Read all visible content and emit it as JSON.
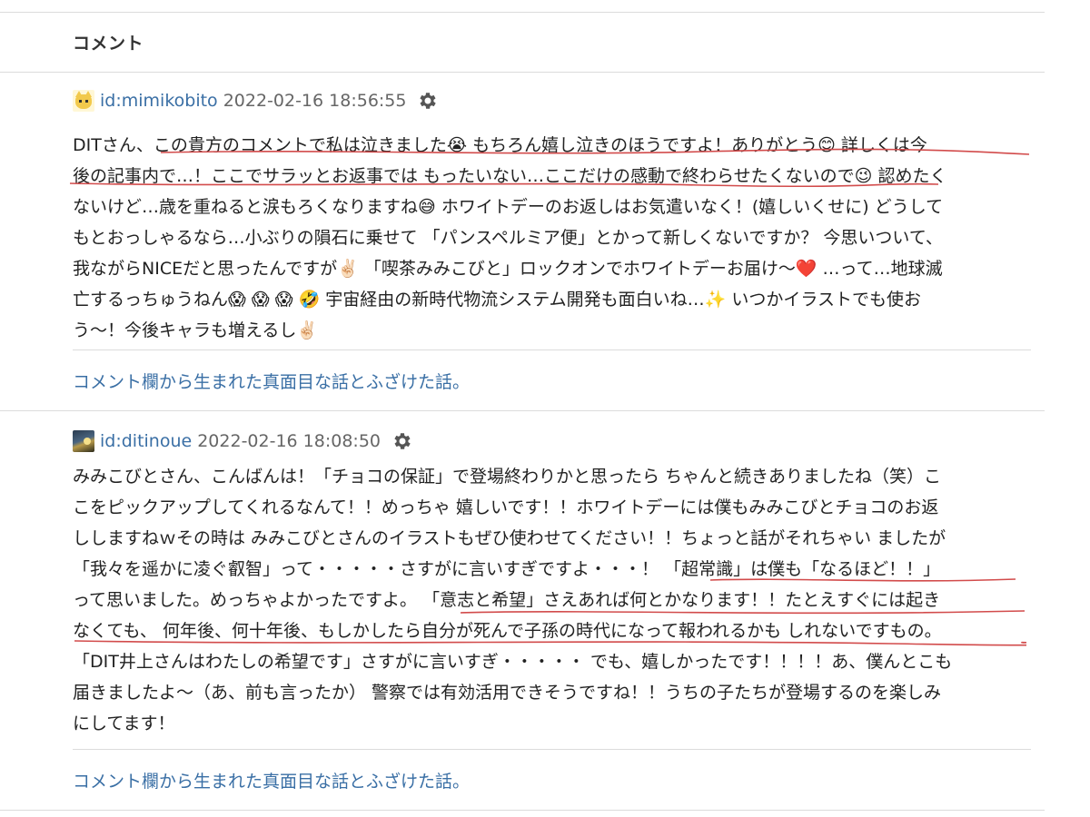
{
  "section": {
    "title": "コメント"
  },
  "comments": [
    {
      "user_id": "id:mimikobito",
      "timestamp": "2022-02-16 18:56:55",
      "avatar_icon": "cat-avatar-icon",
      "lines": [
        "DITさん、この貴方のコメントで私は泣きました😭 もちろん嬉し泣きのほうですよ！ありがとう😊 詳しくは今",
        "後の記事内で…！ここでサラッとお返事では もったいない…ここだけの感動で終わらせたくないので😉 認めたく",
        "ないけど…歳を重ねると涙もろくなりますね😅 ホワイトデーのお返しはお気遣いなく！(嬉しいくせに) どうして",
        "もとおっしゃるなら…小ぶりの隕石に乗せて 「パンスペルミア便」とかって新しくないですか？ 今思いついて、",
        "我ながらNICEだと思ったんですが✌🏻 「喫茶みみこびと」ロックオンでホワイトデーお届け〜❤️ …って…地球滅",
        "亡するっちゅうねん😱 😱 😱 🤣 宇宙経由の新時代物流システム開発も面白いね…✨ いつかイラストでも使お",
        "う〜！今後キャラも増えるし✌🏻"
      ],
      "entry_link": "コメント欄から生まれた真面目な話とふざけた話。"
    },
    {
      "user_id": "id:ditinoue",
      "timestamp": "2022-02-16 18:08:50",
      "avatar_icon": "photo-avatar-icon",
      "lines": [
        "みみこびとさん、こんばんは！「チョコの保証」で登場終わりかと思ったら ちゃんと続きありましたね（笑）こ",
        "こをピックアップしてくれるなんて！！めっちゃ 嬉しいです！！ホワイトデーには僕もみみこびとチョコのお返",
        "ししますねｗその時は みみこびとさんのイラストもぜひ使わせてください！！ちょっと話がそれちゃい ましたが",
        "「我々を遥かに凌ぐ叡智」って・・・・・さすがに言いすぎですよ・・・！ 「超常識」は僕も「なるほど！！」",
        "って思いました。めっちゃよかったですよ。 「意志と希望」さえあれば何とかなります！！たとえすぐには起き",
        "なくても、 何年後、何十年後、もしかしたら自分が死んで子孫の時代になって報われるかも しれないですもの。",
        "「DIT井上さんはわたしの希望です」さすがに言いすぎ・・・・・ でも、嬉しかったです！！！！あ、僕んとこも",
        "届きましたよ〜（あ、前も言ったか） 警察では有効活用できそうですね！！うちの子たちが登場するのを楽しみ",
        "にしてます！"
      ],
      "entry_link": "コメント欄から生まれた真面目な話とふざけた話。"
    }
  ],
  "colors": {
    "link": "#3a6fa5",
    "underline_ink": "#d24b4b",
    "divider": "#dcdcdc"
  }
}
